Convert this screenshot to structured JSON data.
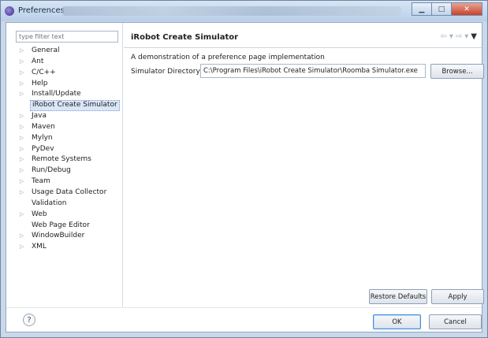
{
  "window": {
    "title": "Preferences",
    "buttons": {
      "minimize": "▁",
      "maximize": "□",
      "close": "✕"
    }
  },
  "sidebar": {
    "filter_placeholder": "type filter text",
    "items": [
      {
        "label": "General",
        "expandable": true
      },
      {
        "label": "Ant",
        "expandable": true
      },
      {
        "label": "C/C++",
        "expandable": true
      },
      {
        "label": "Help",
        "expandable": true
      },
      {
        "label": "Install/Update",
        "expandable": true
      },
      {
        "label": "iRobot Create Simulator",
        "expandable": false,
        "selected": true
      },
      {
        "label": "Java",
        "expandable": true
      },
      {
        "label": "Maven",
        "expandable": true
      },
      {
        "label": "Mylyn",
        "expandable": true
      },
      {
        "label": "PyDev",
        "expandable": true
      },
      {
        "label": "Remote Systems",
        "expandable": true
      },
      {
        "label": "Run/Debug",
        "expandable": true
      },
      {
        "label": "Team",
        "expandable": true
      },
      {
        "label": "Usage Data Collector",
        "expandable": true
      },
      {
        "label": "Validation",
        "expandable": false
      },
      {
        "label": "Web",
        "expandable": true
      },
      {
        "label": "Web Page Editor",
        "expandable": false
      },
      {
        "label": "WindowBuilder",
        "expandable": true
      },
      {
        "label": "XML",
        "expandable": true
      }
    ]
  },
  "page": {
    "title": "iRobot Create Simulator",
    "nav": {
      "back": "⇦",
      "back_menu": "▾",
      "forward": "⇨",
      "forward_menu": "▾",
      "view_menu": "▼"
    },
    "description": "A demonstration of a preference page implementation",
    "directory": {
      "label": "Simulator Directory:",
      "value": "C:\\Program Files\\iRobot Create Simulator\\Roomba Simulator.exe",
      "browse_label": "Browse..."
    },
    "restore_defaults_label": "Restore Defaults",
    "apply_label": "Apply"
  },
  "footer": {
    "help_symbol": "?",
    "ok_label": "OK",
    "cancel_label": "Cancel"
  }
}
